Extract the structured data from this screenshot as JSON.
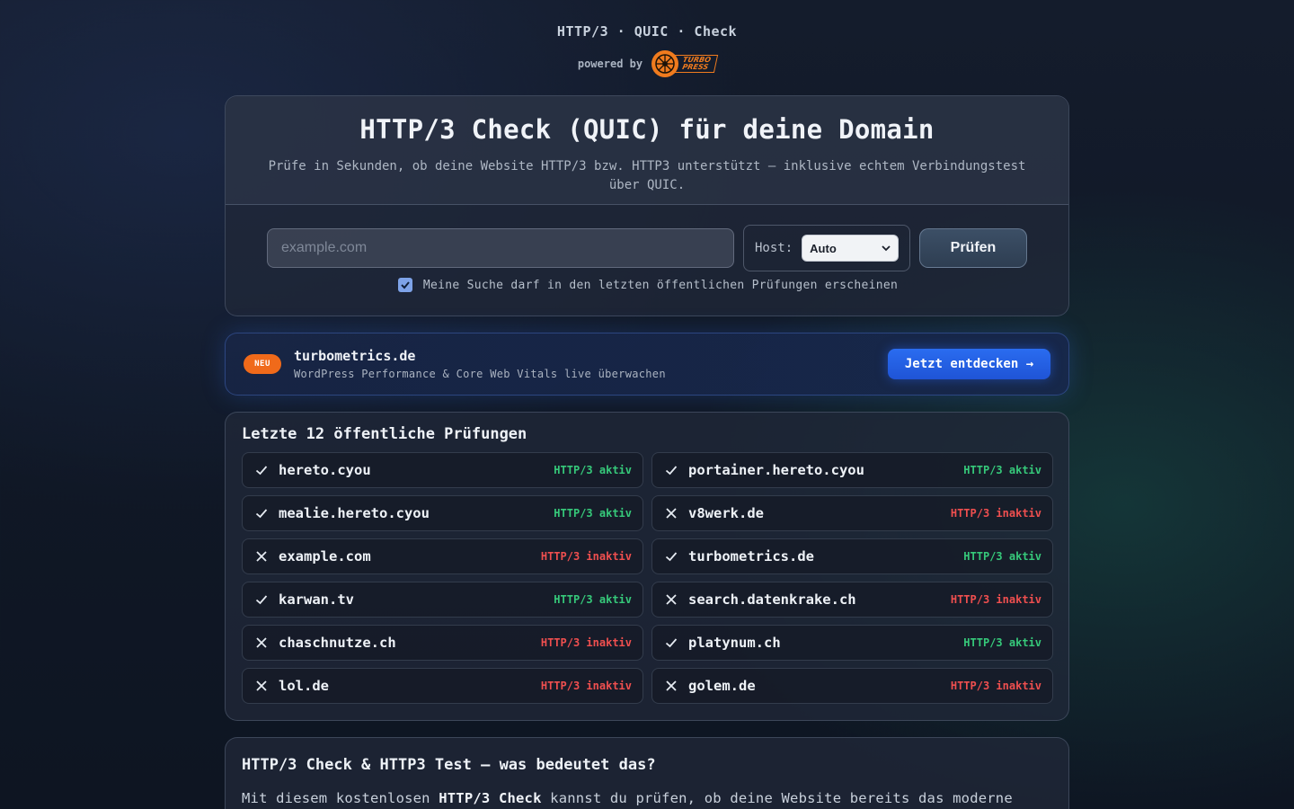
{
  "brand": {
    "title": "HTTP/3 · QUIC · Check",
    "powered_by": "powered by",
    "logo_line1": "TURBO",
    "logo_line2": "PRESS"
  },
  "hero": {
    "title": "HTTP/3 Check (QUIC) für deine Domain",
    "subtitle": "Prüfe in Sekunden, ob deine Website HTTP/3 bzw. HTTP3 unterstützt – inklusive echtem Verbindungstest über QUIC.",
    "input_placeholder": "example.com",
    "input_value": "",
    "host_label": "Host:",
    "host_selected": "Auto",
    "submit_label": "Prüfen",
    "consent_label": "Meine Suche darf in den letzten öffentlichen Prüfungen erscheinen",
    "consent_checked": true
  },
  "promo": {
    "badge": "NEU",
    "title": "turbometrics.de",
    "subtitle": "WordPress Performance & Core Web Vitals live überwachen",
    "button": "Jetzt entdecken →"
  },
  "recent": {
    "title": "Letzte 12 öffentliche Prüfungen",
    "items": [
      {
        "domain": "hereto.cyou",
        "status": "HTTP/3 aktiv",
        "active": true
      },
      {
        "domain": "portainer.hereto.cyou",
        "status": "HTTP/3 aktiv",
        "active": true
      },
      {
        "domain": "mealie.hereto.cyou",
        "status": "HTTP/3 aktiv",
        "active": true
      },
      {
        "domain": "v8werk.de",
        "status": "HTTP/3 inaktiv",
        "active": false
      },
      {
        "domain": "example.com",
        "status": "HTTP/3 inaktiv",
        "active": false
      },
      {
        "domain": "turbometrics.de",
        "status": "HTTP/3 aktiv",
        "active": true
      },
      {
        "domain": "karwan.tv",
        "status": "HTTP/3 aktiv",
        "active": true
      },
      {
        "domain": "search.datenkrake.ch",
        "status": "HTTP/3 inaktiv",
        "active": false
      },
      {
        "domain": "chaschnutze.ch",
        "status": "HTTP/3 inaktiv",
        "active": false
      },
      {
        "domain": "platynum.ch",
        "status": "HTTP/3 aktiv",
        "active": true
      },
      {
        "domain": "lol.de",
        "status": "HTTP/3 inaktiv",
        "active": false
      },
      {
        "domain": "golem.de",
        "status": "HTTP/3 inaktiv",
        "active": false
      }
    ]
  },
  "info": {
    "title": "HTTP/3 Check & HTTP3 Test – was bedeutet das?",
    "text_before": "Mit diesem kostenlosen ",
    "text_bold": "HTTP/3 Check",
    "text_after": " kannst du prüfen, ob deine Website bereits das moderne"
  },
  "colors": {
    "active": "#36c97a",
    "inactive": "#ef4f4f",
    "accent": "#2a6cf0",
    "brand_orange": "#f07b1e"
  }
}
